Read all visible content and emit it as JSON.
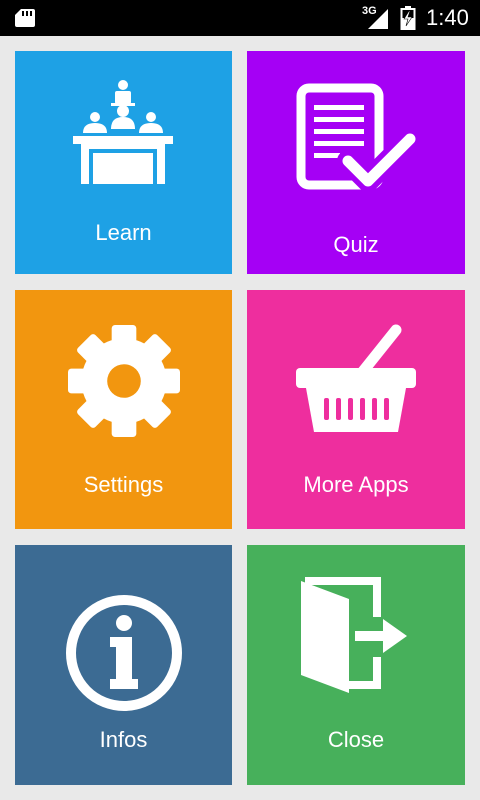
{
  "status_bar": {
    "network_type": "3G",
    "time": "1:40",
    "icons": [
      "sd-card-icon",
      "signal-icon",
      "battery-charging-icon"
    ]
  },
  "tiles": [
    {
      "label": "Learn",
      "color": "#1ea1e5",
      "icon": "classroom-icon"
    },
    {
      "label": "Quiz",
      "color": "#a500f5",
      "icon": "checklist-icon"
    },
    {
      "label": "Settings",
      "color": "#f2960f",
      "icon": "gear-icon"
    },
    {
      "label": "More Apps",
      "color": "#ee2e9e",
      "icon": "basket-icon"
    },
    {
      "label": "Infos",
      "color": "#3c6b93",
      "icon": "info-icon"
    },
    {
      "label": "Close",
      "color": "#47b05b",
      "icon": "exit-door-icon"
    }
  ]
}
